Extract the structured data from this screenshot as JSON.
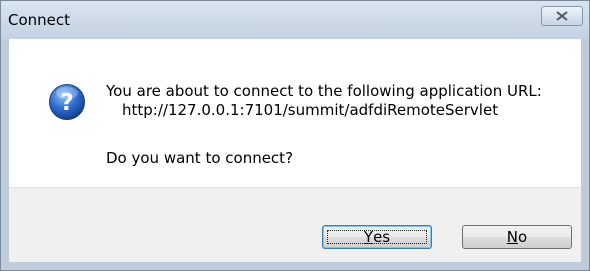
{
  "window": {
    "title": "Connect",
    "close_icon": "close-icon"
  },
  "dialog": {
    "icon": "question-icon",
    "message_line1": "You are about to connect to the following application URL:",
    "url": "http://127.0.0.1:7101/summit/adfdiRemoteServlet",
    "question": "Do you want to connect?"
  },
  "buttons": {
    "yes": {
      "mnemonic": "Y",
      "rest": "es"
    },
    "no": {
      "mnemonic": "N",
      "rest": "o"
    }
  },
  "colors": {
    "titlebar": "#c3d2e2",
    "icon_blue": "#2a62c0"
  }
}
